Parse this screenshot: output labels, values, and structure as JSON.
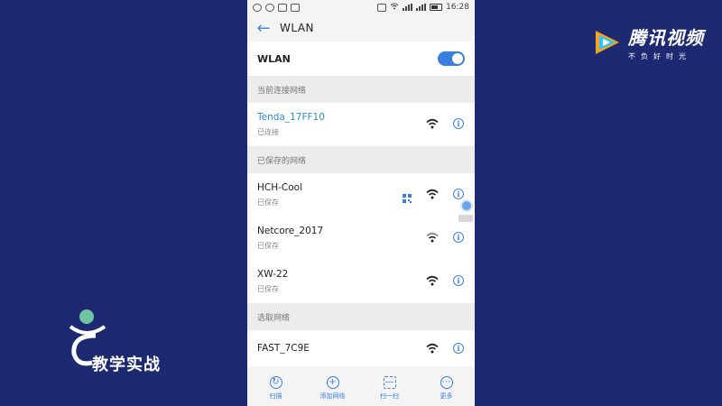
{
  "status_bar": {
    "time": "16:28"
  },
  "header": {
    "back_icon": "arrow-left-icon",
    "title": "WLAN"
  },
  "wlan_toggle": {
    "label": "WLAN",
    "state": "on"
  },
  "sections": {
    "current": "当前连接网络",
    "saved": "已保存的网络",
    "select": "选取网络"
  },
  "current_network": {
    "ssid": "Tenda_17FF10",
    "status": "已连接"
  },
  "saved_networks": [
    {
      "ssid": "HCH-Cool",
      "status": "已保存"
    },
    {
      "ssid": "Netcore_2017",
      "status": "已保存"
    },
    {
      "ssid": "XW-22",
      "status": "已保存"
    }
  ],
  "available_networks": [
    {
      "ssid": "FAST_7C9E"
    }
  ],
  "bottom_bar": [
    {
      "label": "扫描",
      "icon": "scan-icon"
    },
    {
      "label": "添加网络",
      "icon": "add-icon"
    },
    {
      "label": "扫一扫",
      "icon": "qr-scan-icon"
    },
    {
      "label": "更多",
      "icon": "more-icon"
    }
  ],
  "watermarks": {
    "tencent_name": "腾讯视频",
    "tencent_slogan": "不负好时光",
    "course_label": "教学实战"
  },
  "colors": {
    "accent": "#3a7fe0",
    "connected": "#2a8ad6",
    "background": "#1d2a72"
  }
}
